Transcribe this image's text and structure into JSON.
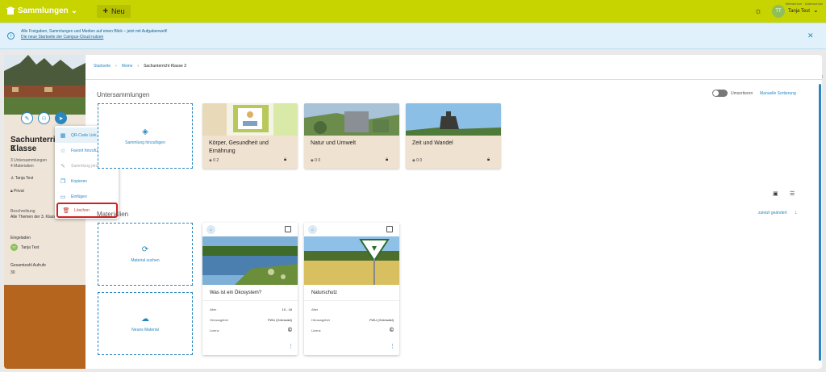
{
  "topbar": {
    "collections_label": "Sammlungen",
    "new_label": "Neu",
    "org_label": "Ministerium · Datenschutz",
    "avatar_initials": "TT",
    "user_name": "Tanja Test"
  },
  "banner": {
    "line1": "Alle Freigaben, Sammlungen und Medien auf einen Blick – jetzt mit Aufgabenwelt!",
    "line2": "Die neue Startseite der Campus-Cloud nutzen"
  },
  "sidebar": {
    "title_line1": "Sachunterricht Klasse",
    "title_line2": "3",
    "subcollections": "3 Untersammlungen",
    "materials": "4 Materialien",
    "owner": "Tanja Test",
    "visibility": "Privat",
    "description_label": "Beschreibung",
    "description": "Alle Themen der 3. Klasse",
    "invited_label": "Eingeladen",
    "invited_initials": "TT",
    "invited_name": "Tanja Test",
    "views_label": "Gesamtzahl Aufrufe",
    "views": "30"
  },
  "context_menu": {
    "items": [
      {
        "label": "QR-Code Link",
        "icon": "qr-icon"
      },
      {
        "label": "Favorit hinzufügen",
        "icon": "star-icon"
      },
      {
        "label": "Sammlung pinnen",
        "icon": "pin-icon"
      },
      {
        "label": "Kopieren",
        "icon": "copy-icon"
      },
      {
        "label": "Einfügen",
        "icon": "paste-icon"
      },
      {
        "label": "Löschen",
        "icon": "trash-icon"
      }
    ]
  },
  "breadcrumb": {
    "home": "Startseite",
    "mine": "Meine",
    "current": "Sachunterricht Klasse 3"
  },
  "subcollections": {
    "title": "Untersammlungen",
    "toggle_label": "Umsortieren",
    "manual_sort": "Manuelle Sortierung",
    "add_label": "Sammlung hinzufügen",
    "cards": [
      {
        "title": "Körper, Gesundheit und Ernährung",
        "meta": "0  2"
      },
      {
        "title": "Natur und Umwelt",
        "meta": "0  0"
      },
      {
        "title": "Zeit und Wandel",
        "meta": "0  0"
      }
    ]
  },
  "materials": {
    "title": "Materialien",
    "sort_label": "zuletzt geändert",
    "search_label": "Material suchen",
    "new_label": "Neues Material",
    "cards": [
      {
        "title": "Was ist ein Ökosystem?",
        "rows": [
          {
            "label": "Alter",
            "value": "10 - 18"
          },
          {
            "label": "Herausgeber",
            "value": "FWU (Grünwald)"
          },
          {
            "label": "Lizenz",
            "value": "©"
          }
        ]
      },
      {
        "title": "Naturschutz",
        "rows": [
          {
            "label": "Alter",
            "value": ""
          },
          {
            "label": "Herausgeber",
            "value": "FWU (Grünwald)"
          },
          {
            "label": "Lizenz",
            "value": "©"
          }
        ]
      }
    ]
  },
  "colors": {
    "brand": "#c8d400",
    "accent": "#2a87c0",
    "danger": "#d02020"
  }
}
